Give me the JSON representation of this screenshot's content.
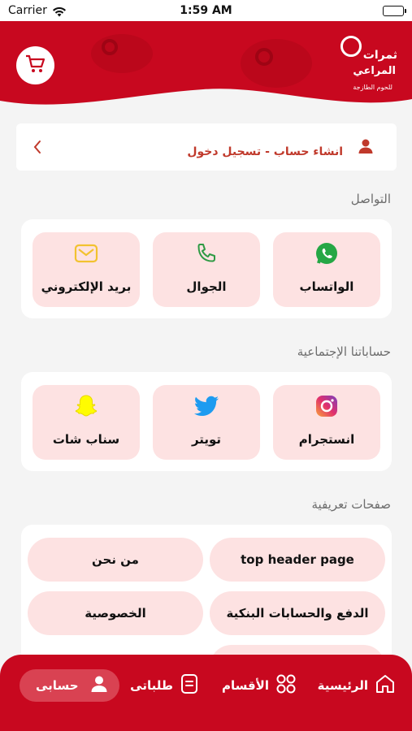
{
  "status_bar": {
    "carrier": "Carrier",
    "time": "1:59 AM"
  },
  "header": {
    "logo_line1": "ثمرات",
    "logo_line2": "المراعي",
    "logo_line3": "للحوم الطازجة"
  },
  "account": {
    "label": "انشاء حساب - تسجيل دخول"
  },
  "contact": {
    "title": "التواصل",
    "items": [
      {
        "label": "الواتساب",
        "icon": "whatsapp-icon"
      },
      {
        "label": "الجوال",
        "icon": "phone-icon"
      },
      {
        "label": "بريد الإلكتروني",
        "icon": "mail-icon"
      }
    ]
  },
  "social": {
    "title": "حساباتنا الإجتماعية",
    "items": [
      {
        "label": "انستجرام",
        "icon": "instagram-icon"
      },
      {
        "label": "تويتر",
        "icon": "twitter-icon"
      },
      {
        "label": "سناب شات",
        "icon": "snapchat-icon"
      }
    ]
  },
  "pages": {
    "title": "صفحات تعريفية",
    "items": [
      {
        "label": "top header page"
      },
      {
        "label": "من نحن"
      },
      {
        "label": "الدفع والحسابات البنكية"
      },
      {
        "label": "الخصوصية"
      }
    ]
  },
  "nav": {
    "items": [
      {
        "label": "الرئيسية",
        "icon": "home-icon"
      },
      {
        "label": "الأقسام",
        "icon": "grid-icon"
      },
      {
        "label": "طلباتى",
        "icon": "orders-icon"
      },
      {
        "label": "حسابى",
        "icon": "user-icon",
        "active": true
      }
    ]
  },
  "colors": {
    "brand": "#c8081f",
    "tile": "#fde2e2",
    "accent_text": "#c0392b"
  }
}
